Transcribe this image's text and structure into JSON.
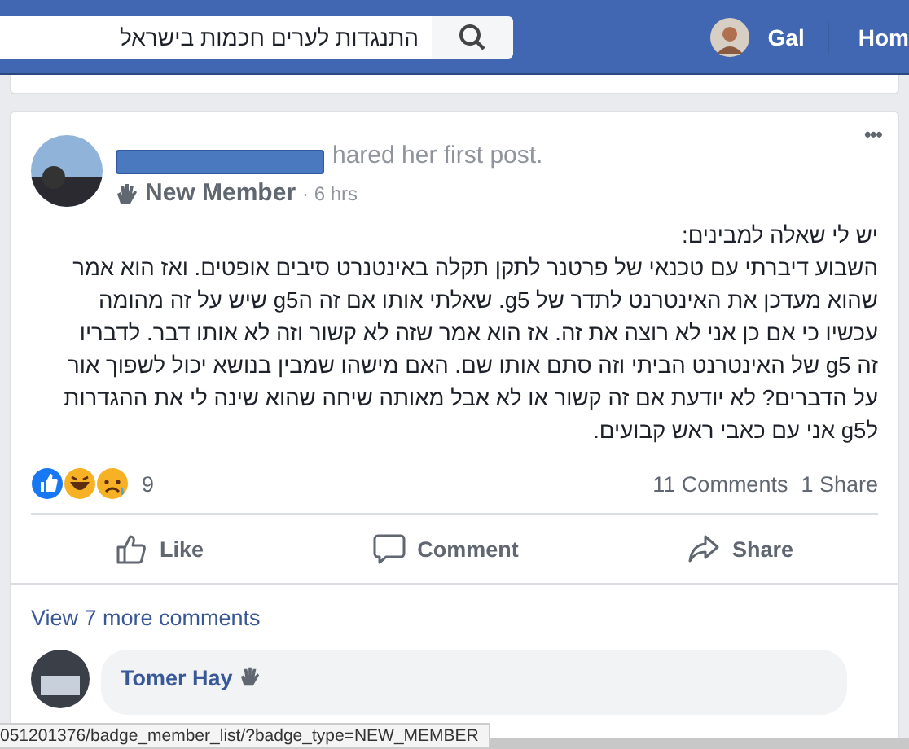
{
  "top_bar": {
    "search": {
      "value": "התנגדות לערים חכמות בישראל"
    },
    "user": "Gal",
    "nav": "Hom"
  },
  "post": {
    "headline": "hared her first post.",
    "name_redacted": true,
    "badge": "New Member",
    "time": "· 6 hrs",
    "more": "•••",
    "body": [
      "יש לי שאלה למבינים:",
      "השבוע דיברתי עם טכנאי של פרטנר לתקן תקלה באינטנרט סיבים אופטים. ואז הוא אמר",
      "שהוא מעדכן את האינטרנט לתדר של g5. שאלתי אותו אם זה הg5 שיש על זה מהומה",
      "עכשיו כי אם כן אני לא רוצה את זה. אז הוא אמר שזה לא קשור וזה לא אותו דבר. לדבריו",
      "זה g5 של האינטרנט הביתי וזה סתם אותו שם. האם מישהו שמבין בנושא יכול לשפוך אור",
      "על הדברים? לא יודעת אם זה קשור או לא אבל מאותה שיחה שהוא שינה לי את ההגדרות",
      "לg5 אני עם כאבי ראש קבועים."
    ],
    "reaction_count": "9",
    "comments_count": "11 Comments",
    "shares_count": "1 Share",
    "like_button": "Like",
    "comment_button": "Comment",
    "share_button": "Share",
    "view_more": "View 7 more comments",
    "comment": {
      "author": "Tomer Hay"
    }
  },
  "status_bar": {
    "url": "051201376/badge_member_list/?badge_type=NEW_MEMBER"
  }
}
